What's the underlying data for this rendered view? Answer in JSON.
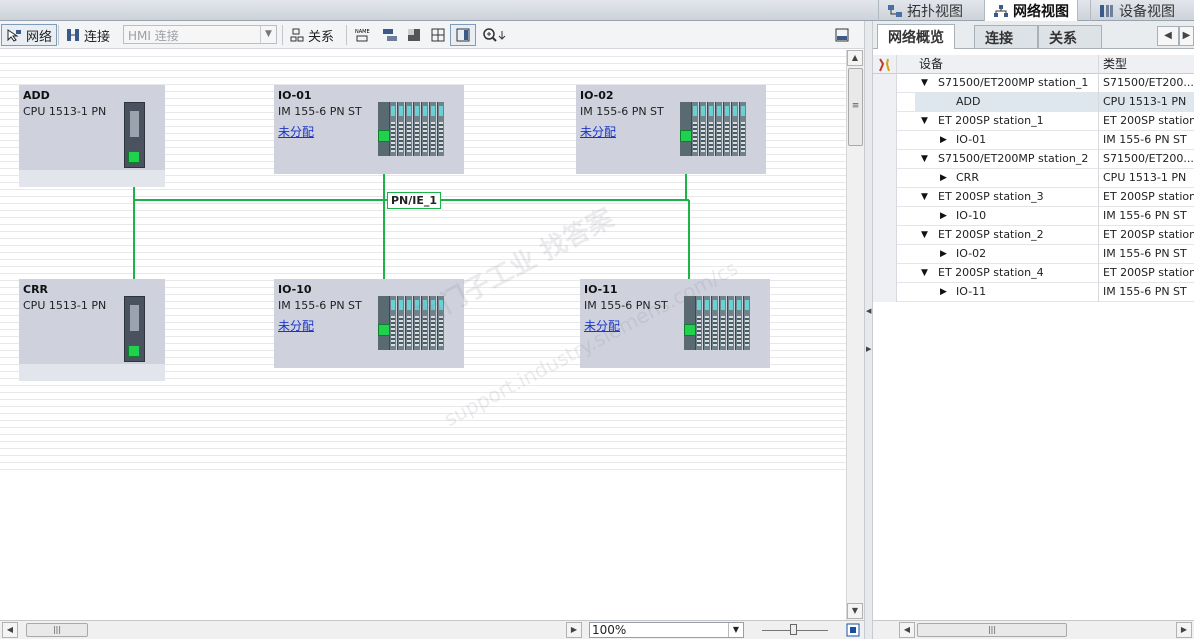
{
  "view_tabs": {
    "topology": "拓扑视图",
    "network": "网络视图",
    "device": "设备视图"
  },
  "toolbar": {
    "network_label": "网络",
    "connections_label": "连接",
    "connection_type_value": "HMI 连接",
    "relations_label": "关系"
  },
  "canvas": {
    "devices": [
      {
        "name": "ADD",
        "type": "CPU 1513-1 PN",
        "link": ""
      },
      {
        "name": "IO-01",
        "type": "IM 155-6 PN ST",
        "link": "未分配"
      },
      {
        "name": "IO-02",
        "type": "IM 155-6 PN ST",
        "link": "未分配"
      },
      {
        "name": "CRR",
        "type": "CPU 1513-1 PN",
        "link": ""
      },
      {
        "name": "IO-10",
        "type": "IM 155-6 PN ST",
        "link": "未分配"
      },
      {
        "name": "IO-11",
        "type": "IM 155-6 PN ST",
        "link": "未分配"
      }
    ],
    "subnet_label": "PN/IE_1",
    "subnet_color": "#1bb34a",
    "watermark_1": "西门子工业 找答案",
    "watermark_2": "support.industry.siemens.com/cs"
  },
  "status": {
    "zoom_value": "100%"
  },
  "overview": {
    "tabs": [
      "网络概览",
      "连接",
      "关系"
    ],
    "columns": {
      "device": "设备",
      "type": "类型"
    },
    "rows": [
      {
        "level": 0,
        "device": "S71500/ET200MP station_1",
        "type": "S71500/ET200..."
      },
      {
        "level": 1,
        "device": "ADD",
        "type": "CPU 1513-1 PN",
        "selected": true
      },
      {
        "level": 0,
        "device": "ET 200SP station_1",
        "type": "ET 200SP station"
      },
      {
        "level": 1,
        "device": "IO-01",
        "type": "IM 155-6 PN ST"
      },
      {
        "level": 0,
        "device": "S71500/ET200MP station_2",
        "type": "S71500/ET200..."
      },
      {
        "level": 1,
        "device": "CRR",
        "type": "CPU 1513-1 PN"
      },
      {
        "level": 0,
        "device": "ET 200SP station_3",
        "type": "ET 200SP station"
      },
      {
        "level": 1,
        "device": "IO-10",
        "type": "IM 155-6 PN ST"
      },
      {
        "level": 0,
        "device": "ET 200SP station_2",
        "type": "ET 200SP station"
      },
      {
        "level": 1,
        "device": "IO-02",
        "type": "IM 155-6 PN ST"
      },
      {
        "level": 0,
        "device": "ET 200SP station_4",
        "type": "ET 200SP station"
      },
      {
        "level": 1,
        "device": "IO-11",
        "type": "IM 155-6 PN ST"
      }
    ]
  }
}
